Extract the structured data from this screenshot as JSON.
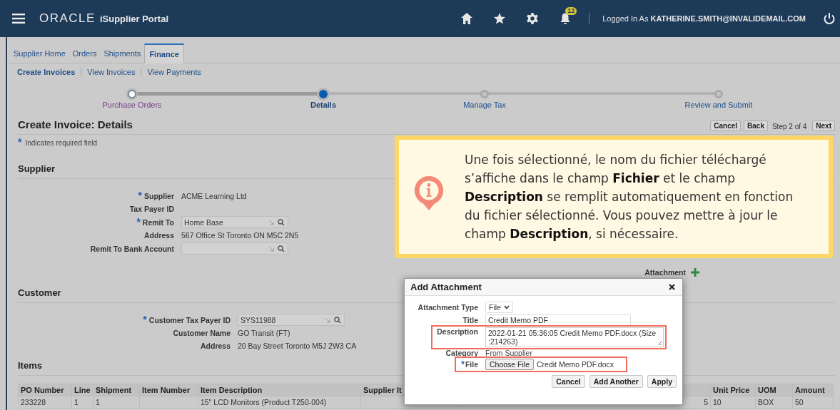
{
  "header": {
    "brand": "ORACLE",
    "app_title": "iSupplier Portal",
    "notification_count": "12",
    "user": "Logged In As **KATHERINE.SMITH@INVALIDEMAIL.COM**"
  },
  "tabs": [
    {
      "label": "Supplier Home",
      "selected": false
    },
    {
      "label": "Orders",
      "selected": false
    },
    {
      "label": "Shipments",
      "selected": false
    },
    {
      "label": "Finance",
      "selected": true
    }
  ],
  "subtabs": [
    {
      "label": "Create Invoices",
      "selected": true
    },
    {
      "label": "View Invoices",
      "selected": false
    },
    {
      "label": "View Payments",
      "selected": false
    }
  ],
  "train": [
    {
      "label": "Purchase Orders",
      "selected": false,
      "visited": true
    },
    {
      "label": "Details",
      "selected": true,
      "visited": true
    },
    {
      "label": "Manage Tax",
      "selected": false,
      "visited": false
    },
    {
      "label": "Review and Submit",
      "selected": false,
      "visited": false
    }
  ],
  "page_title": "Create Invoice: Details",
  "page_buttons": [
    {
      "label": "Cancel"
    },
    {
      "label": "Back"
    }
  ],
  "step_text": "Step 2 of 4",
  "next_button": "Next",
  "required_mark": "*",
  "required_note": "Indicates required field",
  "supplier": {
    "heading": "Supplier",
    "fields": [
      {
        "label": "Supplier",
        "required": true,
        "kind": "text",
        "value": "ACME Learning Ltd"
      },
      {
        "label": "Tax Payer ID",
        "required": false,
        "kind": "text"
      },
      {
        "label": "Remit To",
        "required": true,
        "kind": "lov",
        "value": "Home Base"
      },
      {
        "label": "Address",
        "required": false,
        "kind": "text",
        "value": "567 Office St Toronto ON M5C 2N5"
      },
      {
        "label": "Remit To Bank Account",
        "required": false,
        "kind": "lov"
      }
    ]
  },
  "attachment_label": "Attachment",
  "customer": {
    "heading": "Customer",
    "fields": [
      {
        "label": "Customer Tax Payer ID",
        "required": true,
        "kind": "lov",
        "value": "SYS11988"
      },
      {
        "label": "Customer Name",
        "required": false,
        "kind": "text",
        "value": "GO Transit (FT)"
      },
      {
        "label": "Address",
        "required": false,
        "kind": "text",
        "value": "20 Bay Street Toronto M5J 2W3 CA"
      }
    ]
  },
  "items": {
    "heading": "Items",
    "columns": [
      "PO Number",
      "Line",
      "Shipment",
      "Item Number",
      "Item Description",
      "Supplier It",
      null,
      "Unit Price",
      "UOM",
      "Amount"
    ],
    "rows": [
      [
        "233228",
        "1",
        "1",
        null,
        "15\" LCD Monitors (Product T250-004)",
        null,
        "5",
        "10",
        "BOX",
        "50"
      ]
    ]
  },
  "dialog": {
    "title": "Add Attachment",
    "fields": [
      {
        "label": "Attachment Type",
        "kind": "select",
        "value": "File",
        "highlighted": false,
        "required": false
      },
      {
        "label": "Title",
        "kind": "input",
        "value": "Credit Memo PDF",
        "highlighted": false,
        "required": false
      },
      {
        "label": "Description",
        "kind": "textarea",
        "value": "2022-01-21 05:36:05 Credit Memo PDF.docx (Size :214263)",
        "highlighted": true,
        "required": false
      },
      {
        "label": "Category",
        "kind": "text",
        "value": "From Supplier",
        "highlighted": false,
        "required": false
      },
      {
        "label": "File",
        "kind": "file",
        "button": "Choose File",
        "value": "Credit Memo PDF.docx",
        "highlighted": true,
        "required": true
      }
    ],
    "buttons": [
      "Cancel",
      "Add Another",
      "Apply"
    ]
  },
  "callout": {
    "text": "Une fois sélectionné, le nom du fichier téléchargé s’affiche dans le champ **Fichier** et le champ **Description** se remplit automatiquement en fonction du fichier sélectionné. Vous pouvez mettre à jour le champ **Description**, si nécessaire."
  }
}
